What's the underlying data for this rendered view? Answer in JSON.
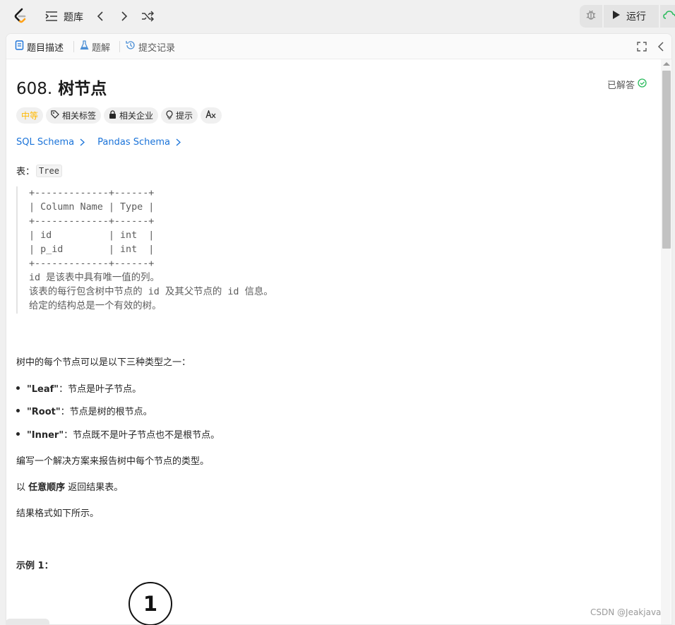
{
  "topbar": {
    "problem_list_label": "题库",
    "run_label": "运行"
  },
  "tabs": [
    {
      "label": "题目描述",
      "icon": "document-icon"
    },
    {
      "label": "题解",
      "icon": "flask-icon"
    },
    {
      "label": "提交记录",
      "icon": "history-icon"
    }
  ],
  "problem": {
    "number": "608.",
    "title": "树节点",
    "status": "已解答",
    "tags": {
      "difficulty": "中等",
      "related_tags": "相关标签",
      "related_companies": "相关企业",
      "hint": "提示"
    },
    "schema_links": [
      "SQL Schema",
      "Pandas Schema"
    ],
    "table_label": "表：",
    "table_name": "Tree",
    "schema_lines": [
      "+-------------+------+",
      "| Column Name | Type |",
      "+-------------+------+",
      "| id          | int  |",
      "| p_id        | int  |",
      "+-------------+------+",
      "id 是该表中具有唯一值的列。",
      "该表的每行包含树中节点的 id 及其父节点的 id 信息。",
      "给定的结构总是一个有效的树。"
    ],
    "intro": "树中的每个节点可以是以下三种类型之一：",
    "types": [
      {
        "name": "\"Leaf\"",
        "desc": "：节点是叶子节点。"
      },
      {
        "name": "\"Root\"",
        "desc": "：节点是树的根节点。"
      },
      {
        "name": "\"Inner\"",
        "desc": "：节点既不是叶子节点也不是根节点。"
      }
    ],
    "task": "编写一个解决方案来报告树中每个节点的类型。",
    "order_prefix": "以 ",
    "order_bold": "任意顺序",
    "order_suffix": " 返回结果表。",
    "format": "结果格式如下所示。",
    "example_label": "示例 1："
  },
  "diagram": {
    "node_label": "1"
  },
  "watermark": "CSDN @Jeakjava",
  "colors": {
    "accent_blue": "#1a73d9",
    "medium": "#ffb800",
    "solved_green": "#2cbb5d"
  }
}
